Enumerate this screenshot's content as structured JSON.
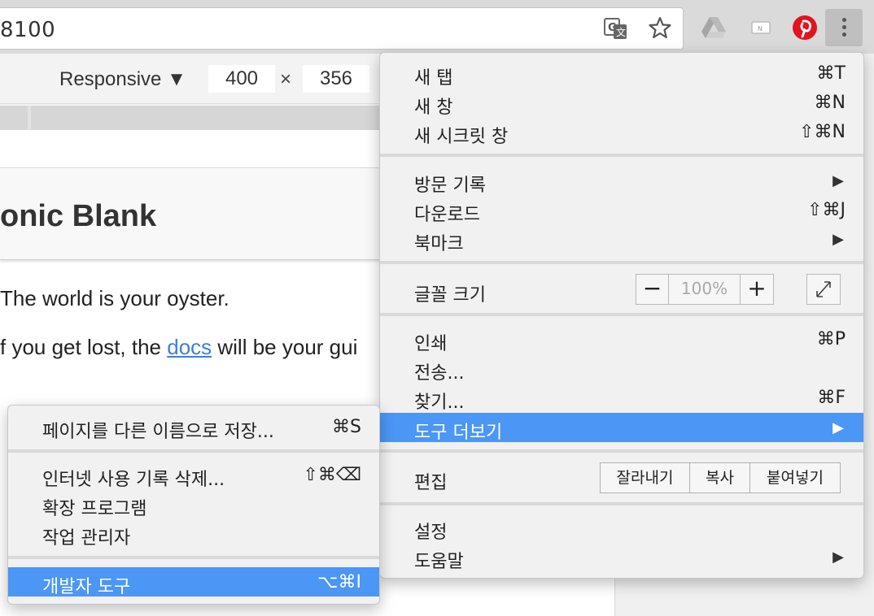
{
  "address_bar": {
    "url_text": "8100"
  },
  "devtools": {
    "device": "Responsive ▼",
    "width": "400",
    "separator": "×",
    "height": "356"
  },
  "page": {
    "title": "onic Blank",
    "line1": "The world is your oyster.",
    "line2_prefix": "f you get lost, the ",
    "line2_link": "docs",
    "line2_suffix": " will be your gui"
  },
  "main_menu": {
    "new_tab": {
      "label": "새 탭",
      "shortcut": "⌘T"
    },
    "new_window": {
      "label": "새 창",
      "shortcut": "⌘N"
    },
    "new_incognito": {
      "label": "새 시크릿 창",
      "shortcut": "⇧⌘N"
    },
    "history": {
      "label": "방문 기록",
      "arrow": "▶"
    },
    "downloads": {
      "label": "다운로드",
      "shortcut": "⇧⌘J"
    },
    "bookmarks": {
      "label": "북마크",
      "arrow": "▶"
    },
    "zoom": {
      "label": "글꼴 크기",
      "minus": "−",
      "value": "100%",
      "plus": "+"
    },
    "print": {
      "label": "인쇄",
      "shortcut": "⌘P"
    },
    "cast": {
      "label": "전송..."
    },
    "find": {
      "label": "찾기...",
      "shortcut": "⌘F"
    },
    "more_tools": {
      "label": "도구 더보기",
      "arrow": "▶"
    },
    "edit": {
      "label": "편집",
      "cut": "잘라내기",
      "copy": "복사",
      "paste": "붙여넣기"
    },
    "settings": {
      "label": "설정"
    },
    "help": {
      "label": "도움말",
      "arrow": "▶"
    }
  },
  "sub_menu": {
    "save_page": {
      "label": "페이지를 다른 이름으로 저장...",
      "shortcut": "⌘S"
    },
    "clear_history": {
      "label": "인터넷 사용 기록 삭제...",
      "shortcut": "⇧⌘⌫"
    },
    "extensions": {
      "label": "확장 프로그램"
    },
    "task_manager": {
      "label": "작업 관리자"
    },
    "devtools": {
      "label": "개발자 도구",
      "shortcut": "⌥⌘I"
    }
  },
  "colors": {
    "highlight": "#4c96f5",
    "link": "#3b7ee8",
    "pinterest": "#e0141e"
  }
}
